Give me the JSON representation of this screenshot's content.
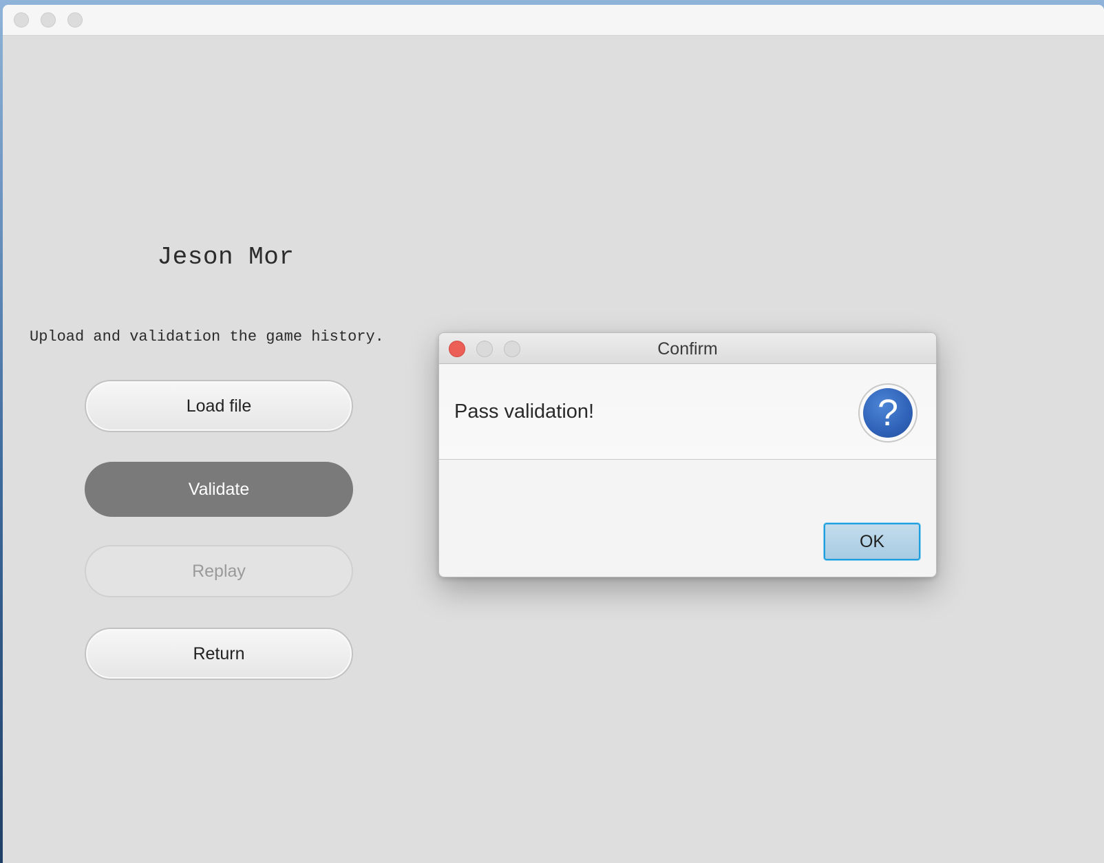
{
  "main_window": {
    "title": "",
    "heading": "Jeson Mor",
    "description": "Upload and validation the game history.",
    "buttons": {
      "load_file": "Load file",
      "validate": "Validate",
      "replay": "Replay",
      "return": "Return"
    }
  },
  "dialog": {
    "title": "Confirm",
    "message": "Pass validation!",
    "icon_glyph": "?",
    "icon": "question-icon",
    "ok_label": "OK"
  },
  "colors": {
    "window_bg": "#dedede",
    "pressed_button": "#7a7a7a",
    "close_button": "#ec5f57",
    "ok_focus": "#1c9fdc",
    "question_icon": "#2f62b8"
  }
}
